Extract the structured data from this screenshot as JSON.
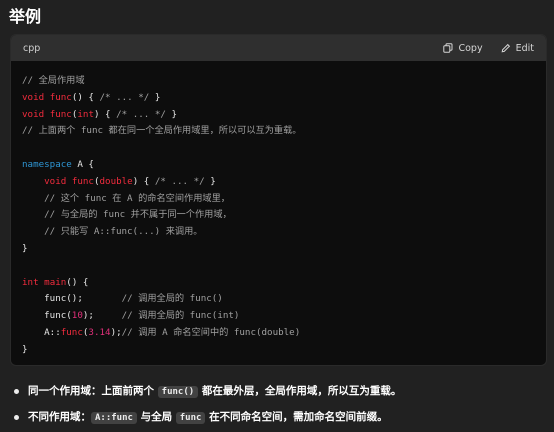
{
  "heading": "举例",
  "code_block": {
    "language": "cpp",
    "copy_label": "Copy",
    "edit_label": "Edit",
    "lines": [
      [
        {
          "t": "// 全局作用域",
          "c": "cm"
        }
      ],
      [
        {
          "t": "void",
          "c": "ty"
        },
        {
          "t": " "
        },
        {
          "t": "func",
          "c": "fn"
        },
        {
          "t": "() { "
        },
        {
          "t": "/* ... */",
          "c": "cm"
        },
        {
          "t": " }"
        }
      ],
      [
        {
          "t": "void",
          "c": "ty"
        },
        {
          "t": " "
        },
        {
          "t": "func",
          "c": "fn"
        },
        {
          "t": "("
        },
        {
          "t": "int",
          "c": "ty"
        },
        {
          "t": ") { "
        },
        {
          "t": "/* ... */",
          "c": "cm"
        },
        {
          "t": " }"
        }
      ],
      [
        {
          "t": "// 上面两个 func 都在同一个全局作用域里，所以可以互为重载。",
          "c": "cm"
        }
      ],
      [
        {
          "t": ""
        }
      ],
      [
        {
          "t": "namespace",
          "c": "kw"
        },
        {
          "t": " A {"
        }
      ],
      [
        {
          "t": "    "
        },
        {
          "t": "void",
          "c": "ty"
        },
        {
          "t": " "
        },
        {
          "t": "func",
          "c": "fn"
        },
        {
          "t": "("
        },
        {
          "t": "double",
          "c": "ty"
        },
        {
          "t": ") { "
        },
        {
          "t": "/* ... */",
          "c": "cm"
        },
        {
          "t": " }"
        }
      ],
      [
        {
          "t": "    "
        },
        {
          "t": "// 这个 func 在 A 的命名空间作用域里，",
          "c": "cm"
        }
      ],
      [
        {
          "t": "    "
        },
        {
          "t": "// 与全局的 func 并不属于同一个作用域，",
          "c": "cm"
        }
      ],
      [
        {
          "t": "    "
        },
        {
          "t": "// 只能写 A::func(...) 来调用。",
          "c": "cm"
        }
      ],
      [
        {
          "t": "}"
        }
      ],
      [
        {
          "t": ""
        }
      ],
      [
        {
          "t": "int",
          "c": "ty"
        },
        {
          "t": " "
        },
        {
          "t": "main",
          "c": "fn"
        },
        {
          "t": "() {"
        }
      ],
      [
        {
          "t": "    func();       "
        },
        {
          "t": "// 调用全局的 func()",
          "c": "cm"
        }
      ],
      [
        {
          "t": "    func("
        },
        {
          "t": "10",
          "c": "nm"
        },
        {
          "t": ");     "
        },
        {
          "t": "// 调用全局的 func(int)",
          "c": "cm"
        }
      ],
      [
        {
          "t": "    A::"
        },
        {
          "t": "func",
          "c": "fn"
        },
        {
          "t": "("
        },
        {
          "t": "3.14",
          "c": "nm"
        },
        {
          "t": ");"
        },
        {
          "t": "// 调用 A 命名空间中的 func(double)",
          "c": "cm"
        }
      ],
      [
        {
          "t": "}"
        }
      ]
    ]
  },
  "bullets": [
    {
      "bold": "同一个作用域",
      "parts": [
        {
          "t": "：上面前两个 "
        },
        {
          "t": "func()",
          "code": true
        },
        {
          "t": " 都在最外层，全局作用域，所以互为重载。"
        }
      ]
    },
    {
      "bold": "不同作用域",
      "parts": [
        {
          "t": "："
        },
        {
          "t": "A::func",
          "code": true
        },
        {
          "t": " 与全局 "
        },
        {
          "t": "func",
          "code": true
        },
        {
          "t": " 在不同命名空间，需加命名空间前缀。"
        }
      ]
    }
  ],
  "icons": {
    "copy": "copy-icon",
    "edit": "edit-icon"
  }
}
